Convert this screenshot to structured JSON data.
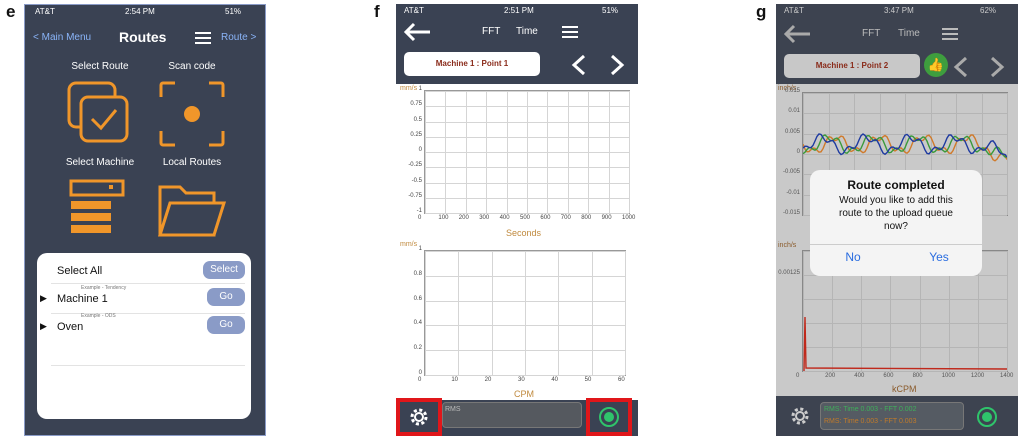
{
  "panels": {
    "e": {
      "letter": "e",
      "status": {
        "carrier": "AT&T",
        "time": "2:54 PM",
        "battery": "51%"
      },
      "header": {
        "back": "< Main Menu",
        "title": "Routes",
        "right": "Route >"
      },
      "tiles": [
        {
          "label": "Select Route",
          "icon": "select-route-icon"
        },
        {
          "label": "Scan code",
          "icon": "scan-code-icon"
        },
        {
          "label": "Select Machine",
          "icon": "select-machine-icon"
        },
        {
          "label": "Local Routes",
          "icon": "folder-icon"
        }
      ],
      "list": {
        "select_all": "Select All",
        "select_button": "Select",
        "items": [
          {
            "caption": "Example - Tendency",
            "name": "Machine 1",
            "button": "Go"
          },
          {
            "caption": "Example - ODS",
            "name": "Oven",
            "button": "Go"
          }
        ]
      },
      "colors": {
        "accent": "#f0962a",
        "bg": "#3a4253"
      }
    },
    "f": {
      "letter": "f",
      "status": {
        "carrier": "AT&T",
        "time": "2:51 PM",
        "battery": "51%"
      },
      "header": {
        "tab1": "FFT",
        "tab2": "Time"
      },
      "point": "Machine 1 : Point 1",
      "bottom": {
        "rms": "RMS"
      },
      "chart1": {
        "unit": "mm/s",
        "yticks": [
          "1",
          "0.75",
          "0.5",
          "0.25",
          "0",
          "-0.25",
          "-0.5",
          "-0.75",
          "-1"
        ],
        "xticks": [
          "0",
          "100",
          "200",
          "300",
          "400",
          "500",
          "600",
          "700",
          "800",
          "900",
          "1000"
        ],
        "xlabel": "Seconds"
      },
      "chart2": {
        "unit": "mm/s",
        "yticks": [
          "1",
          "0.8",
          "0.6",
          "0.4",
          "0.2",
          "0"
        ],
        "xticks": [
          "0",
          "10",
          "20",
          "30",
          "40",
          "50",
          "60"
        ],
        "xlabel": "CPM"
      }
    },
    "g": {
      "letter": "g",
      "status": {
        "carrier": "AT&T",
        "time": "3:47 PM",
        "battery": "62%"
      },
      "header": {
        "tab1": "FFT",
        "tab2": "Time"
      },
      "point": "Machine 1 : Point 2",
      "chart1": {
        "unit": "inch/s",
        "yticks": [
          "0.015",
          "0.01",
          "0.005",
          "0",
          "-0.005",
          "-0.01",
          "-0.015"
        ]
      },
      "chart2": {
        "unit": "inch/s",
        "yticks": [
          "0.00125"
        ],
        "xticks": [
          "0",
          "200",
          "400",
          "600",
          "800",
          "1000",
          "1200",
          "1400"
        ],
        "xlabel": "kCPM"
      },
      "dialog": {
        "title": "Route completed",
        "message": "Would you like to add this route to the upload queue now?",
        "no": "No",
        "yes": "Yes"
      },
      "bottom": {
        "line1": "RMS: Time 0.003 - FFT 0.002",
        "line2": "RMS: Time 0.003 - FFT 0.003"
      }
    }
  }
}
